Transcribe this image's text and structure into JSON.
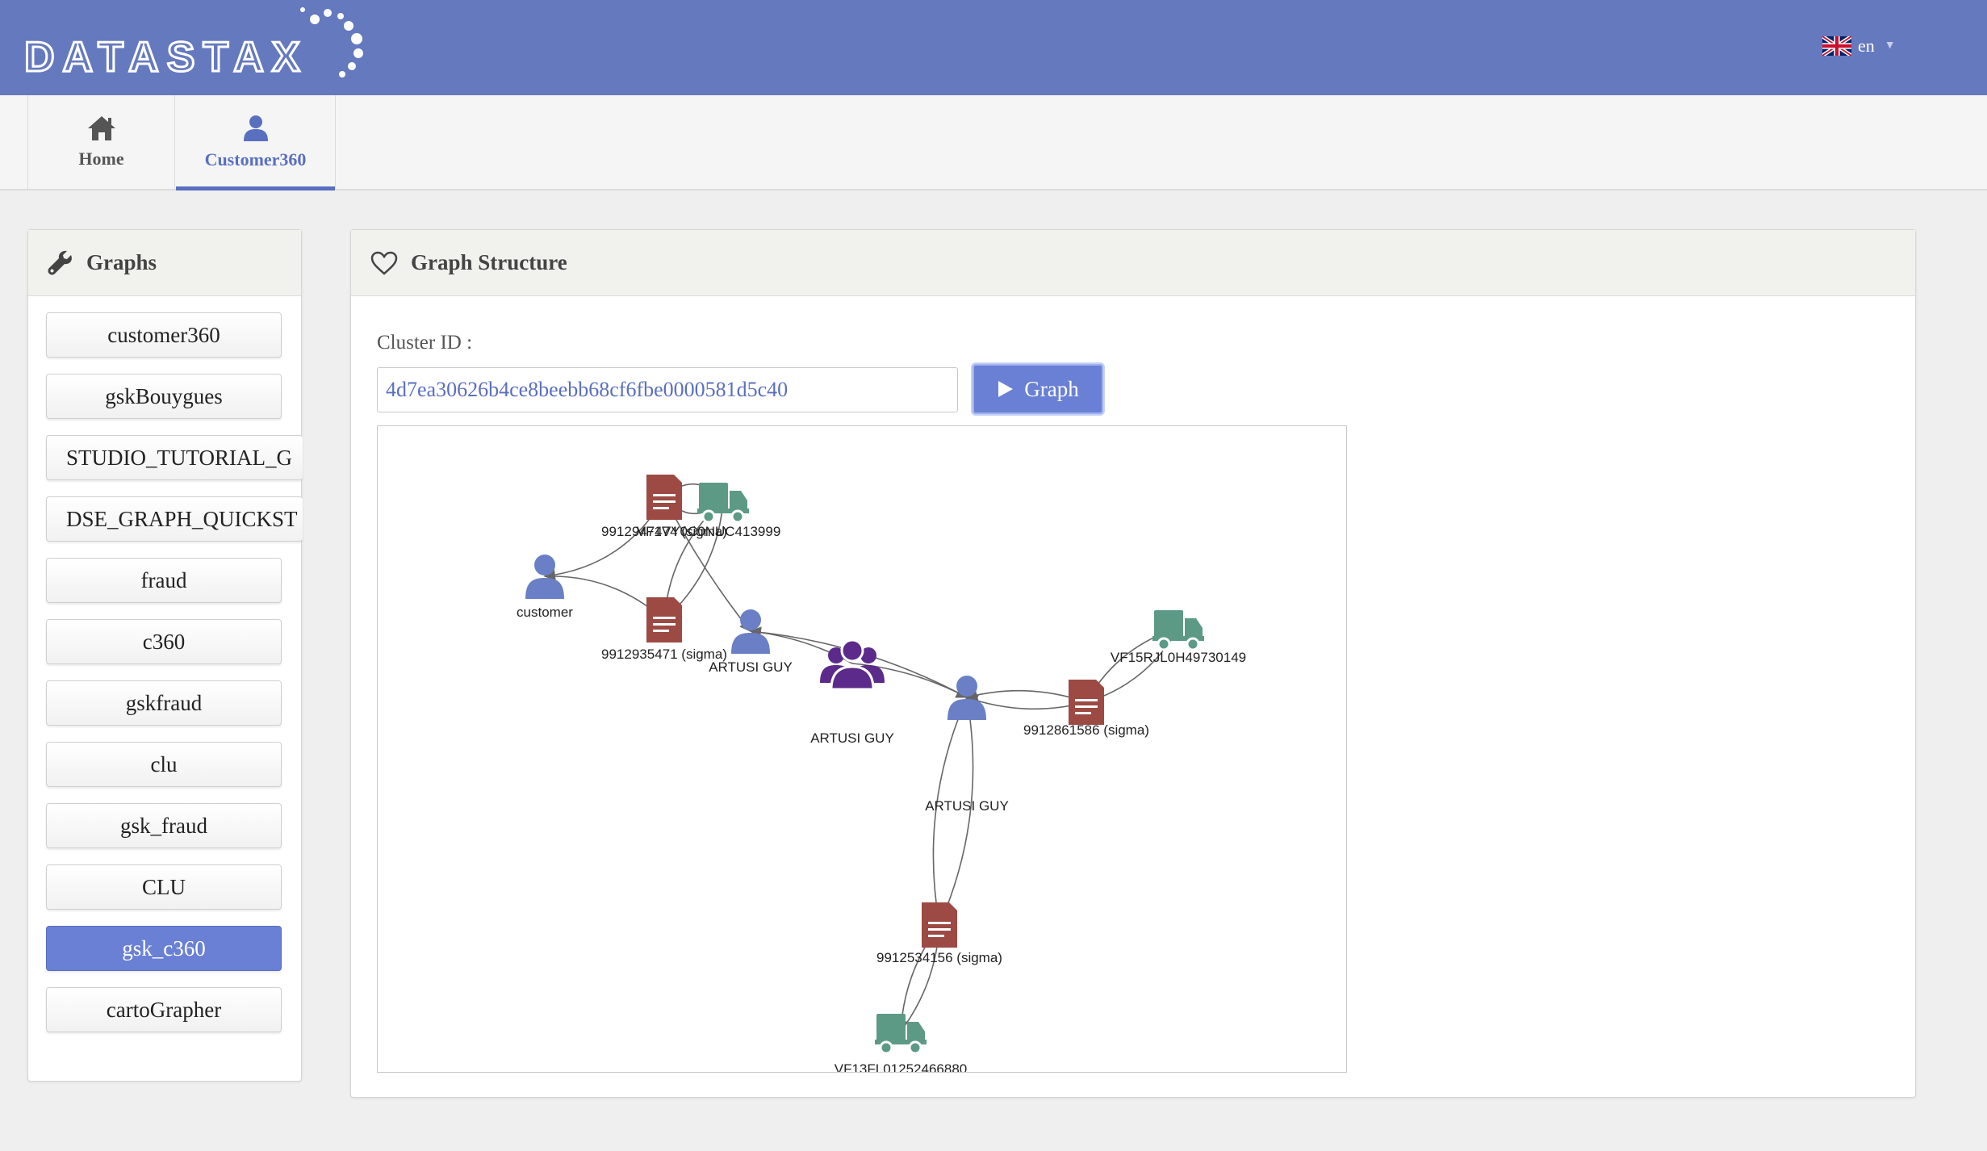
{
  "header": {
    "logo_text": "DATASTAX",
    "language": "en",
    "language_flag": "uk-flag-icon"
  },
  "nav": {
    "tabs": [
      {
        "label": "Home",
        "icon": "home-icon",
        "active": false
      },
      {
        "label": "Customer360",
        "icon": "user-icon",
        "active": true
      }
    ]
  },
  "sidebar": {
    "title": "Graphs",
    "icon": "wrench-icon",
    "graphs": [
      {
        "label": "customer360",
        "active": false
      },
      {
        "label": "gskBouygues",
        "active": false
      },
      {
        "label": "STUDIO_TUTORIAL_G",
        "active": false
      },
      {
        "label": "DSE_GRAPH_QUICKST",
        "active": false
      },
      {
        "label": "fraud",
        "active": false
      },
      {
        "label": "c360",
        "active": false
      },
      {
        "label": "gskfraud",
        "active": false
      },
      {
        "label": "clu",
        "active": false
      },
      {
        "label": "gsk_fraud",
        "active": false
      },
      {
        "label": "CLU",
        "active": false
      },
      {
        "label": "gsk_c360",
        "active": true
      },
      {
        "label": "cartoGrapher",
        "active": false
      }
    ]
  },
  "main": {
    "title": "Graph Structure",
    "icon": "heart-icon",
    "cluster_label": "Cluster ID :",
    "cluster_value": "4d7ea30626b4ce8beebb68cf6fbe0000581d5c40",
    "graph_button": "Graph",
    "graph_button_icon": "play-icon"
  },
  "graph": {
    "nodes": [
      {
        "id": "doc1",
        "type": "document",
        "label": "9912947474 (sigma)"
      },
      {
        "id": "truck1",
        "type": "truck",
        "label": "VF1VY0C0NUC413999"
      },
      {
        "id": "cust",
        "type": "person",
        "label": "customer"
      },
      {
        "id": "doc2",
        "type": "document",
        "label": "9912935471 (sigma)"
      },
      {
        "id": "p1",
        "type": "person",
        "label": "ARTUSI GUY"
      },
      {
        "id": "grp",
        "type": "group",
        "label": "ARTUSI GUY"
      },
      {
        "id": "p2",
        "type": "person",
        "label": "ARTUSI GUY"
      },
      {
        "id": "truck2",
        "type": "truck",
        "label": "VF15RJL0H49730149"
      },
      {
        "id": "doc3",
        "type": "document",
        "label": "9912861586 (sigma)"
      },
      {
        "id": "doc4",
        "type": "document",
        "label": "9912534156 (sigma)"
      },
      {
        "id": "truck3",
        "type": "truck",
        "label": "VF13FL01252466880"
      }
    ],
    "colors": {
      "person": "#6a7fc6",
      "group": "#5b2a8a",
      "document": "#9c4a43",
      "truck": "#5c9a86",
      "edge": "#666666"
    }
  }
}
